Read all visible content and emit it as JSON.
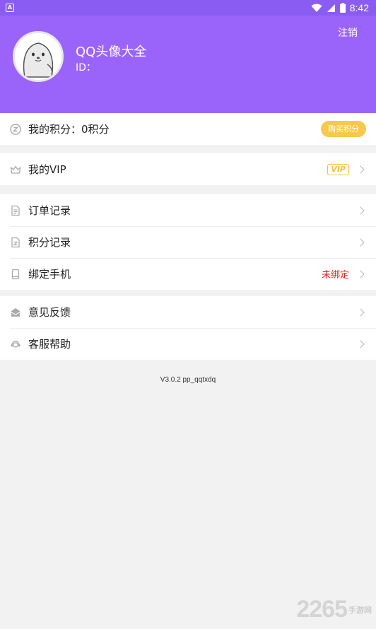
{
  "status_bar": {
    "time": "8:42",
    "app_icon_letter": "A"
  },
  "header": {
    "logout": "注销",
    "username": "QQ头像大全",
    "id_label": "ID："
  },
  "points": {
    "label": "我的积分：",
    "value": "0积分",
    "buy_button": "购买积分"
  },
  "vip": {
    "label": "我的VIP",
    "badge": "VIP"
  },
  "records": {
    "orders": "订单记录",
    "points_history": "积分记录",
    "bind_phone": "绑定手机",
    "bind_status": "未绑定"
  },
  "support": {
    "feedback": "意见反馈",
    "help": "客服帮助"
  },
  "version": "V3.0.2 pp_qqtxdq",
  "watermark": {
    "number": "2265",
    "text": "手游网"
  },
  "colors": {
    "header": "#9a64fb",
    "statusbar": "#8a5cf2",
    "accent_yellow": "#f8c84a",
    "alert_red": "#e0251f"
  }
}
